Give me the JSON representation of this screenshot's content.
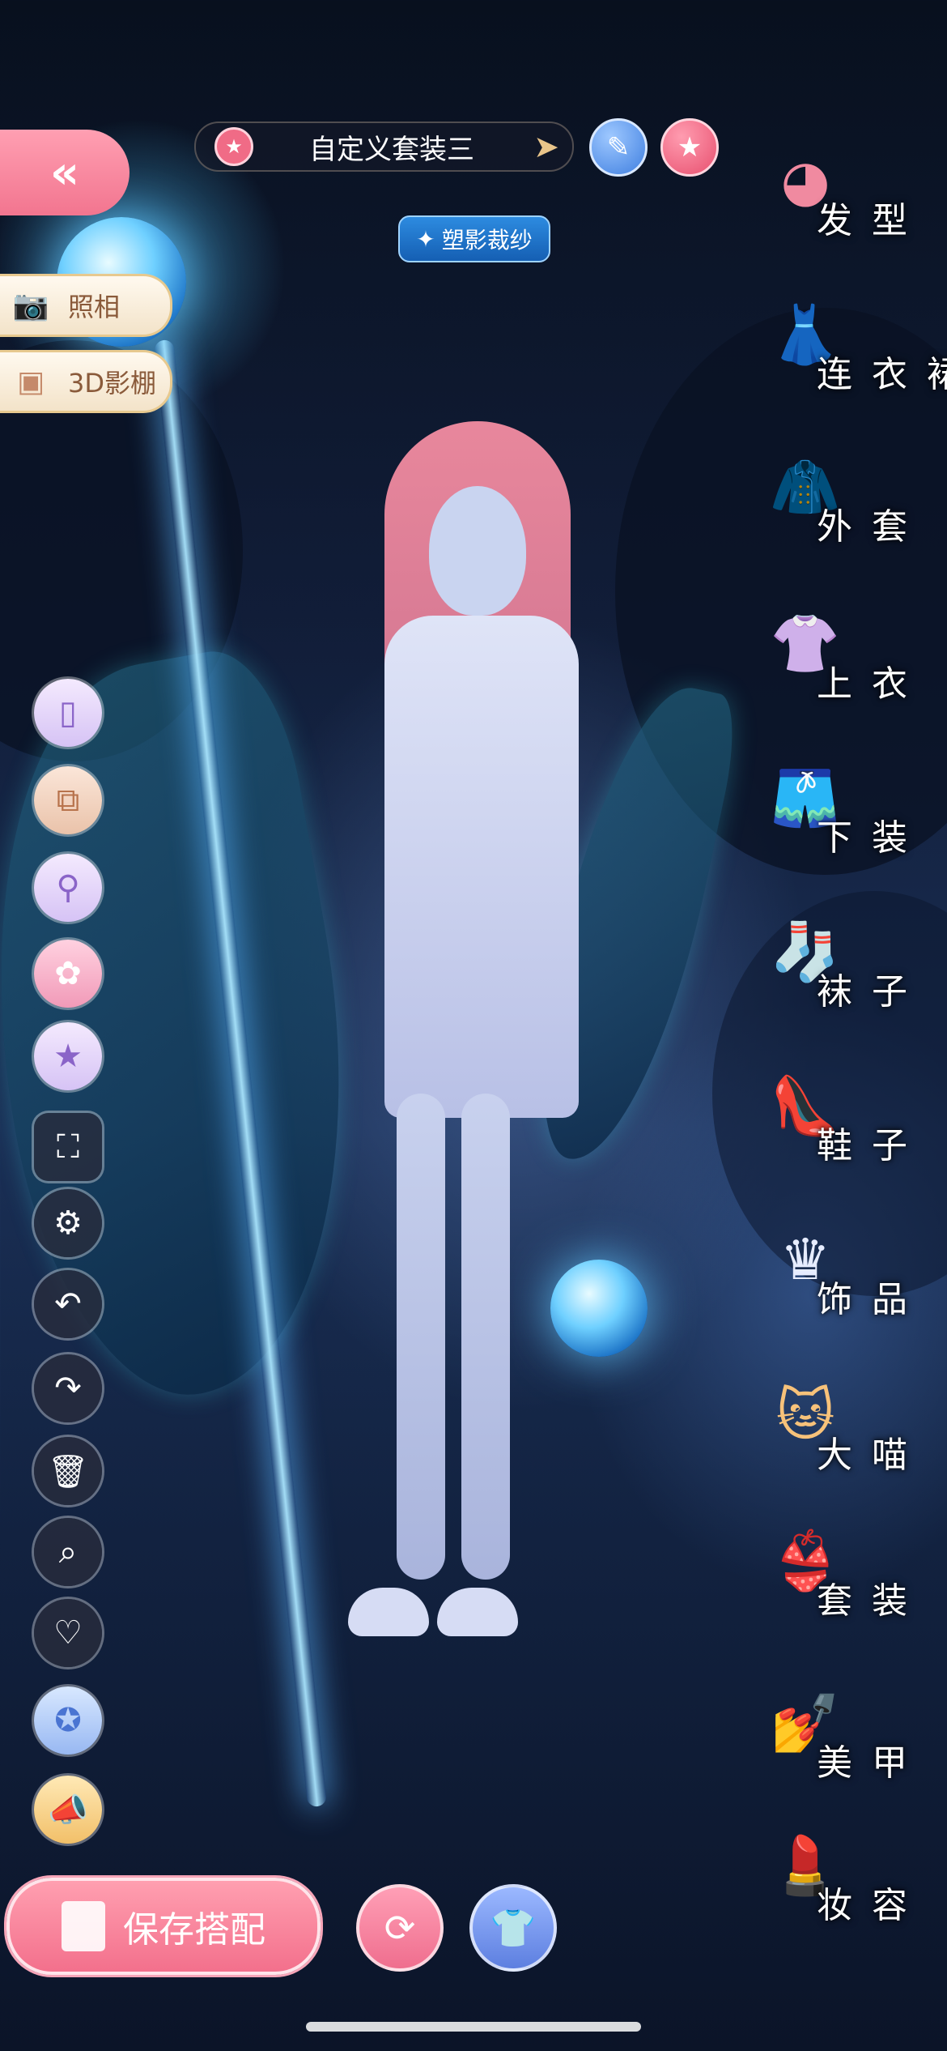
{
  "top": {
    "back_icon": "double-chevron-left",
    "outfit_title": "自定义套装三",
    "edit_icon": "pencil",
    "favorite_icon": "star"
  },
  "badge": {
    "label": "塑影裁纱"
  },
  "side_buttons": {
    "photo_label": "照相",
    "studio_label": "3D影棚"
  },
  "tools": [
    {
      "name": "phone-tool",
      "icon": "phone"
    },
    {
      "name": "layers-tool",
      "icon": "layers"
    },
    {
      "name": "character-adjust-tool",
      "icon": "person-adjust"
    },
    {
      "name": "palette-tool",
      "icon": "palette"
    },
    {
      "name": "sparkle-star-tool",
      "icon": "star"
    },
    {
      "name": "fullscreen-tool",
      "icon": "fullscreen"
    },
    {
      "name": "settings-tool",
      "icon": "gear"
    },
    {
      "name": "undo-tool",
      "icon": "undo"
    },
    {
      "name": "redo-tool",
      "icon": "redo"
    },
    {
      "name": "delete-tool",
      "icon": "trash"
    },
    {
      "name": "search-tool",
      "icon": "magnifier"
    },
    {
      "name": "like-tool",
      "icon": "heart"
    },
    {
      "name": "star-badge-tool",
      "icon": "star-badge"
    },
    {
      "name": "announce-tool",
      "icon": "megaphone"
    }
  ],
  "bottom": {
    "save_label": "保存搭配",
    "share_icon": "rotate-arrow",
    "outfit_scan_icon": "shirt-scan"
  },
  "categories": [
    {
      "label": "发型",
      "icon": "hair"
    },
    {
      "label": "连衣裙",
      "icon": "dress"
    },
    {
      "label": "外套",
      "icon": "coat"
    },
    {
      "label": "上衣",
      "icon": "shirt"
    },
    {
      "label": "下装",
      "icon": "shorts"
    },
    {
      "label": "袜子",
      "icon": "sock"
    },
    {
      "label": "鞋子",
      "icon": "shoe"
    },
    {
      "label": "饰品",
      "icon": "tiara"
    },
    {
      "label": "大喵",
      "icon": "cat"
    },
    {
      "label": "套装",
      "icon": "outfit-set"
    },
    {
      "label": "美甲",
      "icon": "nail-polish"
    },
    {
      "label": "妆容",
      "icon": "makeup"
    }
  ]
}
